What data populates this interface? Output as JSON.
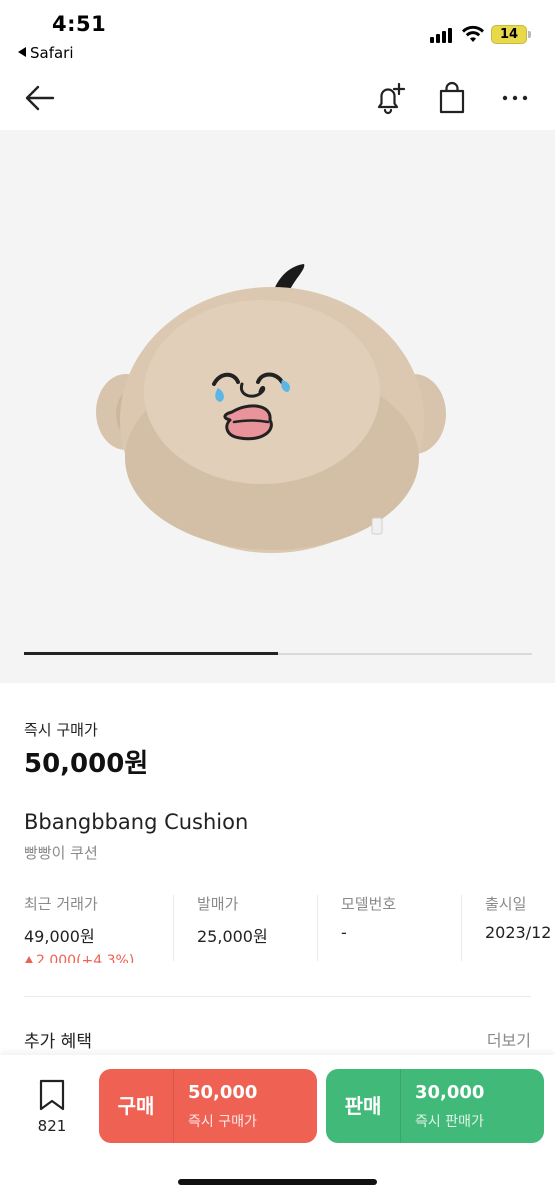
{
  "status_bar": {
    "time": "4:51",
    "back_app": "Safari",
    "battery": "14"
  },
  "gallery": {
    "progress": 0.5
  },
  "product": {
    "price_label": "즉시 구매가",
    "price": "50,000원",
    "name_en": "Bbangbbang Cushion",
    "name_ko": "빵빵이 쿠션"
  },
  "info": [
    {
      "label": "최근 거래가",
      "value": "49,000원",
      "change": "2,000(+4.3%)"
    },
    {
      "label": "발매가",
      "value": "25,000원"
    },
    {
      "label": "모델번호",
      "value": "-"
    },
    {
      "label": "출시일",
      "value": "2023/12"
    }
  ],
  "benefits": {
    "title": "추가 혜택",
    "more": "더보기"
  },
  "bottom": {
    "bookmark_count": "821",
    "buy": {
      "label": "구매",
      "amount": "50,000",
      "sub": "즉시 구매가",
      "color": "#ef6253"
    },
    "sell": {
      "label": "판매",
      "amount": "30,000",
      "sub": "즉시 판매가",
      "color": "#41b979"
    }
  },
  "icons": [
    "back-arrow-icon",
    "bell-plus-icon",
    "shopping-bag-icon",
    "more-icon",
    "bookmark-icon"
  ]
}
